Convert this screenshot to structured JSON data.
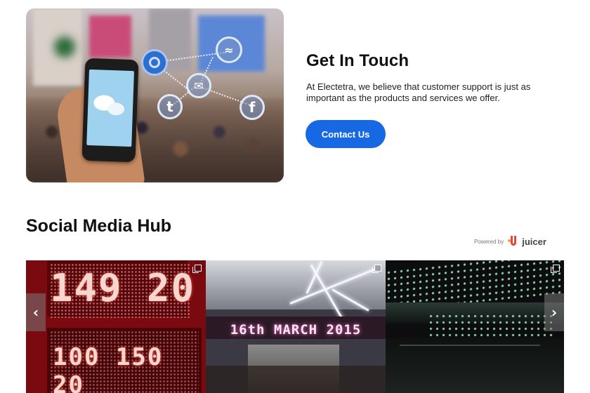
{
  "get_in_touch": {
    "title": "Get In Touch",
    "body": "At Electetra, we believe that customer support is just as important as the products and services we offer.",
    "button_label": "Contact Us",
    "button_color": "#1668e3"
  },
  "hero_image": {
    "icons": [
      "chat-icon",
      "wifi-icon",
      "mail-icon",
      "twitter-icon",
      "facebook-icon"
    ],
    "icon_letters": {
      "twitter": "t",
      "facebook": "f"
    }
  },
  "social_hub": {
    "title": "Social Media Hub",
    "powered_by": "Powered by",
    "provider": "juicer",
    "tiles": [
      {
        "led_top": "149 20",
        "led_bottom": "100 150 20"
      },
      {
        "banner": "16th MARCH 2015"
      },
      {
        "kind": "green-led-lights"
      }
    ],
    "prev_arrow": "‹",
    "next_arrow": "›"
  }
}
